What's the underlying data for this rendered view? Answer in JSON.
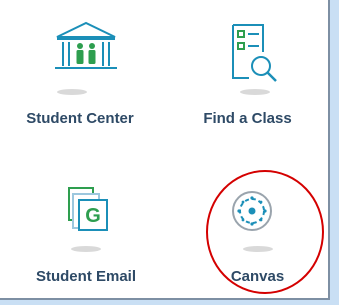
{
  "tiles": [
    {
      "label": "Student Center",
      "icon": "building-people-icon"
    },
    {
      "label": "Find a Class",
      "icon": "search-list-icon"
    },
    {
      "label": "Student Email",
      "icon": "gmail-g-icon",
      "icon_letter": "G"
    },
    {
      "label": "Canvas",
      "icon": "canvas-logo-icon"
    }
  ],
  "colors": {
    "label": "#2e4a66",
    "icon_teal": "#1b8fb8",
    "icon_green": "#2e9e4f",
    "highlight": "#d40000",
    "background": "#c9dff4"
  }
}
